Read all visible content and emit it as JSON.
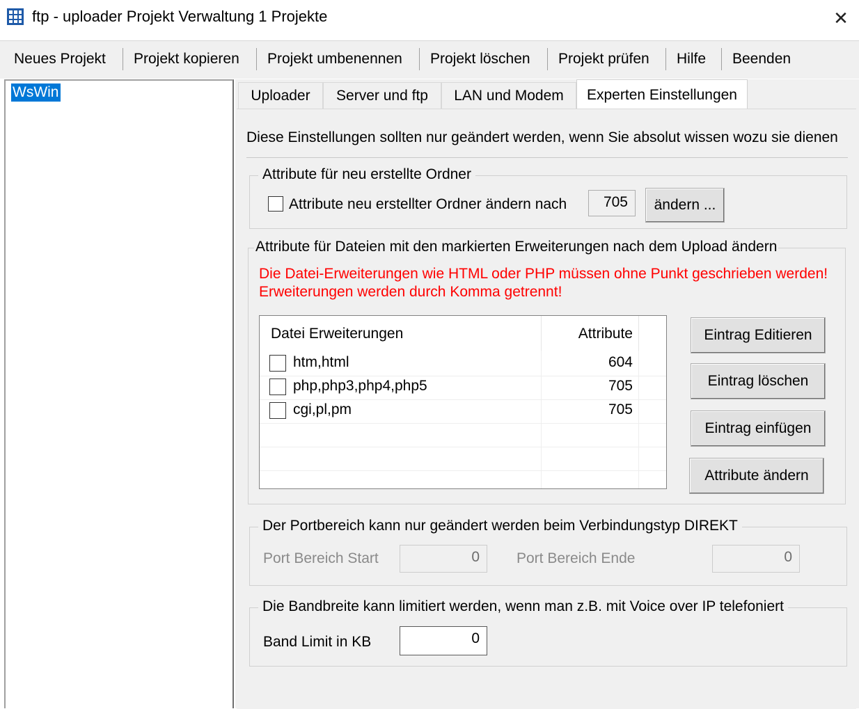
{
  "window": {
    "title": "ftp - uploader Projekt Verwaltung 1 Projekte",
    "close_glyph": "✕"
  },
  "menu": [
    "Neues Projekt",
    "Projekt kopieren",
    "Projekt umbenennen",
    "Projekt löschen",
    "Projekt prüfen",
    "Hilfe",
    "Beenden"
  ],
  "tree": {
    "selected_item": "WsWin"
  },
  "tabs": [
    "Uploader",
    "Server und ftp",
    "LAN und Modem",
    "Experten Einstellungen"
  ],
  "active_tab": "Experten Einstellungen",
  "warning_text": "Diese Einstellungen sollten nur geändert werden, wenn Sie absolut wissen wozu sie dienen",
  "folder_group": {
    "title": "Attribute für neu erstellte Ordner",
    "checkbox_label": "Attribute neu erstellter Ordner ändern nach",
    "checked": false,
    "value": "705",
    "button": "ändern ..."
  },
  "files_group": {
    "title": "Attribute für Dateien mit den markierten Erweiterungen nach dem Upload ändern",
    "note_line1": "Die Datei-Erweiterungen wie HTML oder PHP müssen ohne Punkt geschrieben werden!",
    "note_line2": "Erweiterungen werden durch Komma getrennt!",
    "columns": [
      "Datei Erweiterungen",
      "Attribute"
    ],
    "rows": [
      {
        "ext": "htm,html",
        "attr": "604",
        "checked": false
      },
      {
        "ext": "php,php3,php4,php5",
        "attr": "705",
        "checked": false
      },
      {
        "ext": "cgi,pl,pm",
        "attr": "705",
        "checked": false
      }
    ],
    "buttons": [
      "Eintrag Editieren",
      "Eintrag löschen",
      "Eintrag einfügen",
      "Attribute ändern"
    ]
  },
  "port_group": {
    "title": "Der Portbereich kann nur geändert werden beim Verbindungstyp DIREKT",
    "start_label": "Port Bereich Start",
    "start_value": "0",
    "end_label": "Port Bereich Ende",
    "end_value": "0"
  },
  "bandwidth_group": {
    "title": "Die Bandbreite kann limitiert werden, wenn man z.B. mit Voice over IP telefoniert",
    "label": "Band Limit in KB",
    "value": "0"
  },
  "colors": {
    "selection": "#0078d7",
    "note_red": "#ff0000",
    "panel_bg": "#f0f0f0"
  },
  "icons": {
    "app": "grid-app-icon",
    "close": "close-icon"
  }
}
